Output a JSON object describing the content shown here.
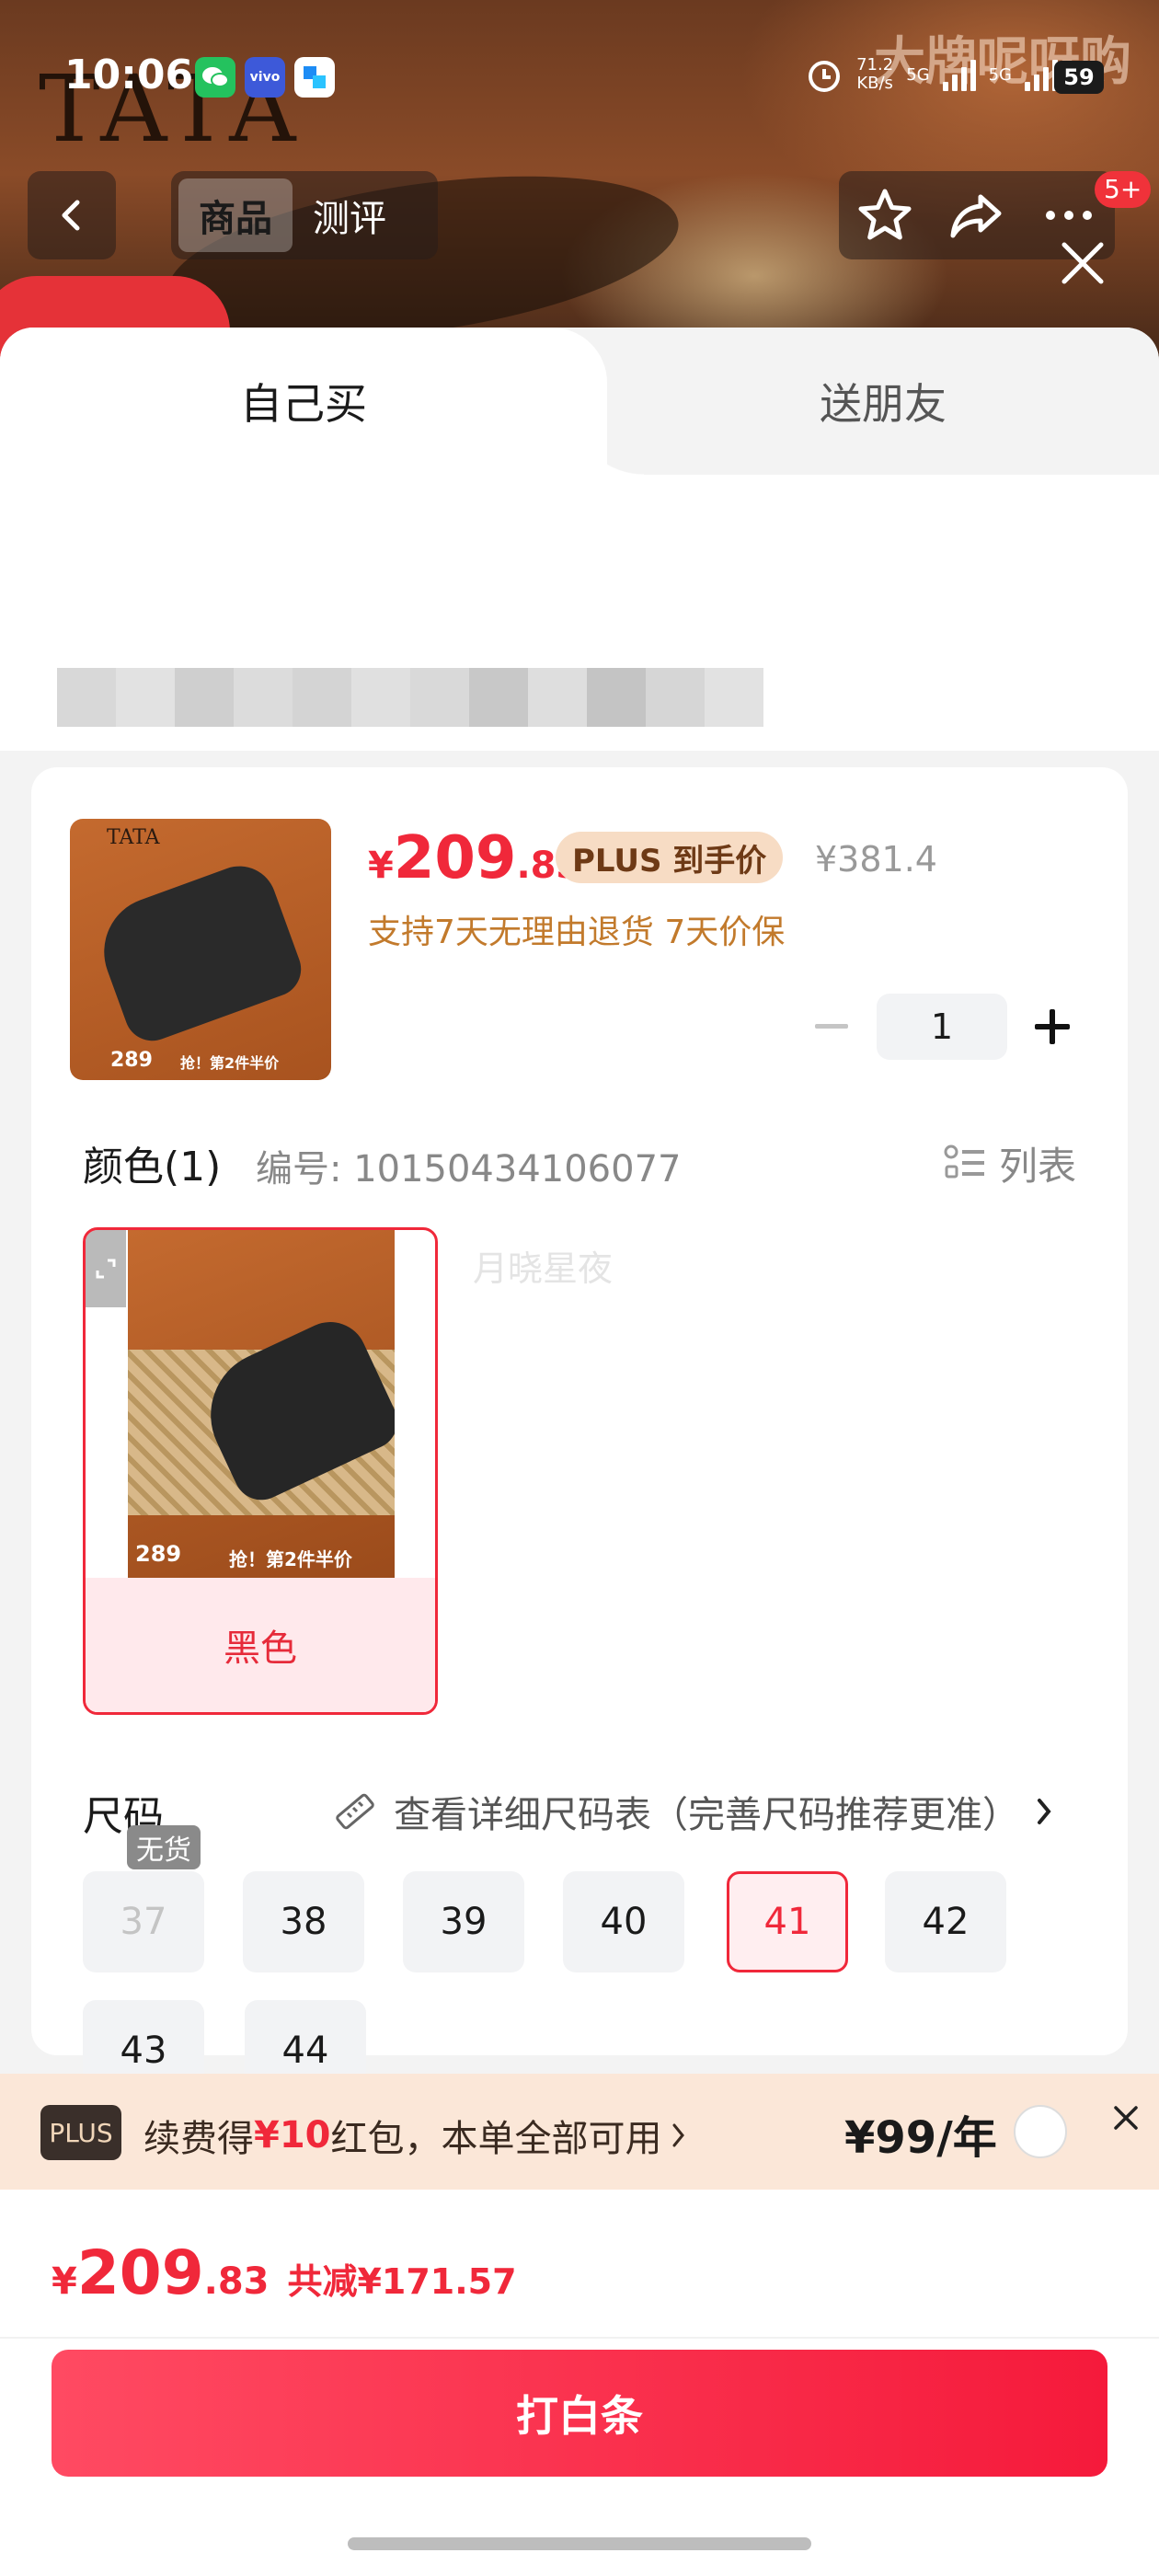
{
  "background": {
    "brand_watermark": "TATA",
    "corner_brand": "大牌呢呀购"
  },
  "status_bar": {
    "time": "10:06",
    "apps": [
      "wechat",
      "vivo",
      "app"
    ],
    "net_speed": "71.2\nKB/s",
    "network_1": "5G",
    "network_2": "5G",
    "battery": "59"
  },
  "nav": {
    "tabs": [
      {
        "label": "商品",
        "active": true
      },
      {
        "label": "测评",
        "active": false
      }
    ],
    "notification_count": "5+"
  },
  "sheet": {
    "tabs": [
      {
        "label": "自己买",
        "active": true
      },
      {
        "label": "送朋友",
        "active": false
      }
    ]
  },
  "product": {
    "price_yen": "¥",
    "price_int": "209",
    "price_dec": ".83",
    "plus_tag": "PLUS 到手价",
    "original_price": "¥381.4",
    "guarantee": "支持7天无理由退货  7天价保",
    "quantity": "1",
    "thumb_brand": "TATA",
    "thumb_price": "289",
    "thumb_promo": "抢！第2件半价"
  },
  "color_section": {
    "title": "颜色(1)",
    "sku_number": "编号: 10150434106077",
    "list_toggle": "列表",
    "watermark": "月晓星夜",
    "options": [
      {
        "label": "黑色",
        "selected": true
      }
    ]
  },
  "size_section": {
    "title": "尺码",
    "guide_link": "查看详细尺码表（完善尺码推荐更准）",
    "out_of_stock_tag": "无货",
    "sizes": [
      {
        "label": "37",
        "state": "disabled"
      },
      {
        "label": "38",
        "state": "normal"
      },
      {
        "label": "39",
        "state": "normal"
      },
      {
        "label": "40",
        "state": "normal"
      },
      {
        "label": "41",
        "state": "selected"
      },
      {
        "label": "42",
        "state": "normal"
      },
      {
        "label": "43",
        "state": "normal"
      },
      {
        "label": "44",
        "state": "normal"
      }
    ]
  },
  "plus_banner": {
    "pill": "PLUS",
    "text_prefix": "续费得",
    "text_highlight": "¥10",
    "text_suffix": "红包，本单全部可用",
    "fee": "¥99/年"
  },
  "footer": {
    "price_yen": "¥",
    "price_int": "209",
    "price_dec": ".83",
    "saved": "共减¥171.57",
    "pay_button": "打白条"
  },
  "colors": {
    "accent_red": "#f0283a",
    "plus_gold": "#f7dcc4",
    "guarantee_orange": "#c27a2c"
  }
}
